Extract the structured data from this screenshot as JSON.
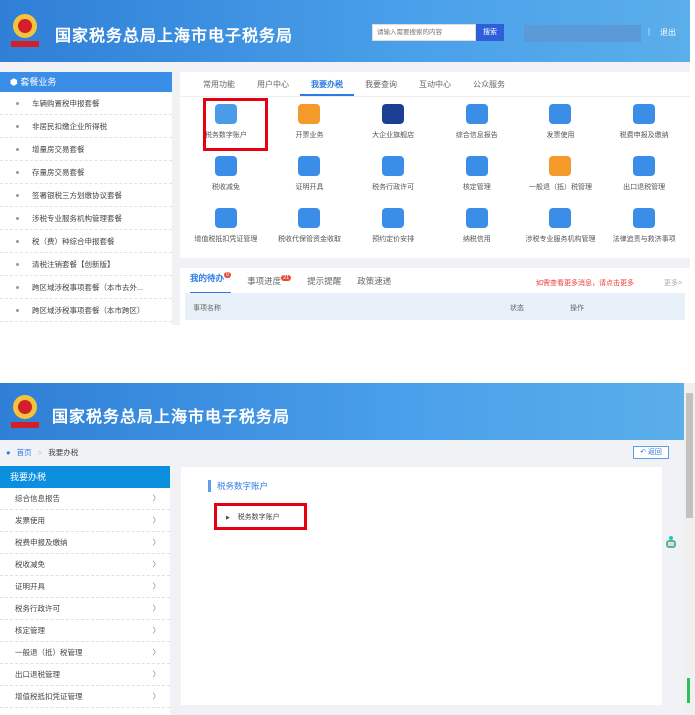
{
  "top": {
    "header": {
      "title": "国家税务总局上海市电子税务局",
      "search_placeholder": "请输入需要搜索的内容",
      "search_button": "搜索",
      "separator": "|",
      "logout": "退出"
    },
    "sidebar": {
      "title": "套餐业务",
      "items": [
        "车辆购置税申报套餐",
        "非居民扣缴企业所得税",
        "增量房交易套餐",
        "存量房交易套餐",
        "签署银税三方划缴协议套餐",
        "涉税专业服务机构管理套餐",
        "税（费）种综合申报套餐",
        "清税注销套餐【创新版】",
        "跨区域涉税事项套餐（本市去外...",
        "跨区域涉税事项套餐（本市跨区）"
      ]
    },
    "tabs": [
      "常用功能",
      "用户中心",
      "我要办税",
      "我要查询",
      "互动中心",
      "公众服务"
    ],
    "active_tab": "我要办税",
    "functions": [
      {
        "label": "税务数字账户",
        "icon": "digital-account-icon",
        "color": "#4a9be8"
      },
      {
        "label": "开票业务",
        "icon": "invoice-issue-icon",
        "color": "#f39a2b"
      },
      {
        "label": "大企业旗舰店",
        "icon": "enterprise-logo-icon",
        "color": "#1c3f94"
      },
      {
        "label": "综合信息报告",
        "icon": "report-icon",
        "color": "#3a8ee8"
      },
      {
        "label": "发票使用",
        "icon": "invoice-use-icon",
        "color": "#3a8ee8"
      },
      {
        "label": "税费申报及缴纳",
        "icon": "tax-declare-icon",
        "color": "#3a8ee8"
      },
      {
        "label": "税收减免",
        "icon": "tax-relief-icon",
        "color": "#3a8ee8"
      },
      {
        "label": "证明开具",
        "icon": "certificate-icon",
        "color": "#3a8ee8"
      },
      {
        "label": "税务行政许可",
        "icon": "permit-icon",
        "color": "#3a8ee8"
      },
      {
        "label": "核定管理",
        "icon": "stamp-icon",
        "color": "#3a8ee8"
      },
      {
        "label": "一般退（抵）税管理",
        "icon": "refund-icon",
        "color": "#f39a2b"
      },
      {
        "label": "出口退税管理",
        "icon": "export-refund-icon",
        "color": "#3a8ee8"
      },
      {
        "label": "增值税抵扣凭证管理",
        "icon": "voucher-icon",
        "color": "#3a8ee8"
      },
      {
        "label": "税收代保管资金收取",
        "icon": "custody-fund-icon",
        "color": "#3a8ee8"
      },
      {
        "label": "预约定价安排",
        "icon": "calendar-icon",
        "color": "#3a8ee8"
      },
      {
        "label": "纳税信用",
        "icon": "credit-icon",
        "color": "#3a8ee8"
      },
      {
        "label": "涉税专业服务机构管理",
        "icon": "agency-icon",
        "color": "#3a8ee8"
      },
      {
        "label": "法律追责与救济事项",
        "icon": "gavel-icon",
        "color": "#3a8ee8"
      }
    ],
    "todo": {
      "tabs": [
        {
          "label": "我的待办",
          "badge": "0"
        },
        {
          "label": "事项进度",
          "badge": "21"
        },
        {
          "label": "提示提醒"
        },
        {
          "label": "政策速递"
        }
      ],
      "notice": "如需查看更多消息，请点击更多",
      "more": "更多>",
      "columns": [
        "事项名称",
        "状态",
        "操作"
      ]
    }
  },
  "bottom": {
    "header": {
      "title": "国家税务总局上海市电子税务局"
    },
    "breadcrumb": [
      "首页",
      "我要办税"
    ],
    "back": "返回",
    "sidebar": {
      "title": "我要办税",
      "items": [
        "综合信息报告",
        "发票使用",
        "税费申报及缴纳",
        "税收减免",
        "证明开具",
        "税务行政许可",
        "核定管理",
        "一般退（抵）税管理",
        "出口退税管理",
        "增值税抵扣凭证管理"
      ]
    },
    "section_title": "税务数字账户",
    "section_item": "税务数字账户"
  }
}
